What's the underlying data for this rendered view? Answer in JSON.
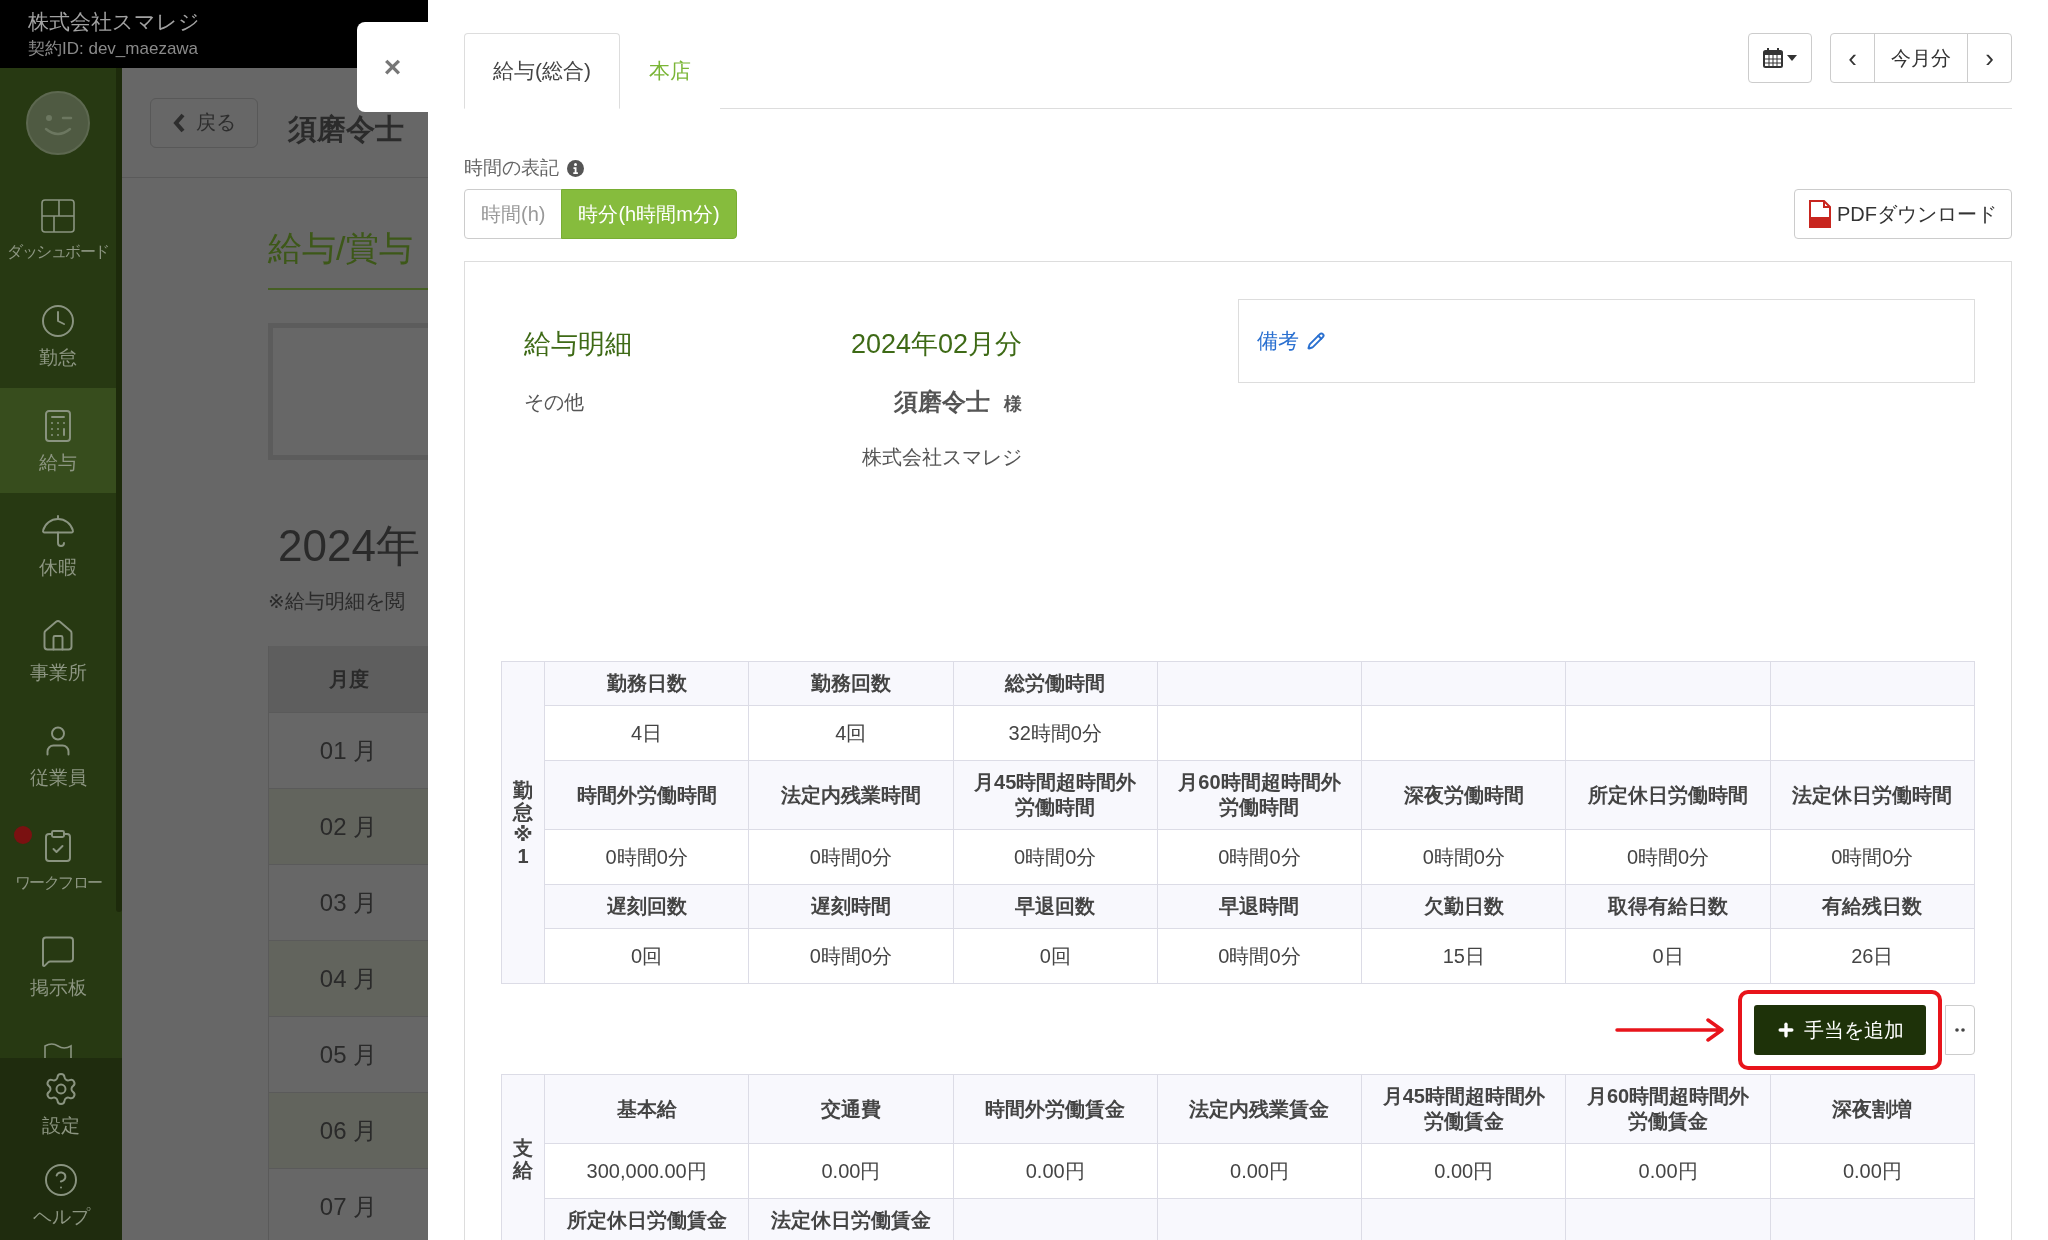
{
  "top_bar": {
    "company": "株式会社スマレジ",
    "contract_id": "契約ID: dev_maezawa"
  },
  "sidebar": {
    "items": [
      {
        "label": "ダッシュボード",
        "selected": false,
        "alert": false
      },
      {
        "label": "勤怠",
        "selected": false,
        "alert": false
      },
      {
        "label": "給与",
        "selected": true,
        "alert": false
      },
      {
        "label": "休暇",
        "selected": false,
        "alert": false
      },
      {
        "label": "事業所",
        "selected": false,
        "alert": false
      },
      {
        "label": "従業員",
        "selected": false,
        "alert": false
      },
      {
        "label": "ワークフロー",
        "selected": false,
        "alert": true
      },
      {
        "label": "掲示板",
        "selected": false,
        "alert": false
      }
    ],
    "footer_items": [
      {
        "label": "設定"
      },
      {
        "label": "ヘルプ"
      }
    ]
  },
  "page": {
    "back_button": "戻る",
    "employee_name": "須磨令士",
    "title": "給与/賞与",
    "year": "2024年",
    "note": "※給与明細を閲",
    "months_table": {
      "header": "月度",
      "rows": [
        "01 月",
        "02 月",
        "03 月",
        "04 月",
        "05 月",
        "06 月",
        "07 月"
      ]
    }
  },
  "drawer": {
    "close_button": "×",
    "tabs": [
      {
        "label": "給与(総合)",
        "selected": true
      },
      {
        "label": "本店",
        "selected": false
      }
    ],
    "pager": {
      "previous": "‹",
      "current": "今月分",
      "next": "›"
    },
    "time_format": {
      "label": "時間の表記",
      "options": [
        {
          "label": "時間(h)",
          "selected": false
        },
        {
          "label": "時分(h時間m分)",
          "selected": true
        }
      ]
    },
    "pdf_button": "PDFダウンロード",
    "slip": {
      "title": "給与明細",
      "period": "2024年02月分",
      "category": "その他",
      "employee": "須磨令士",
      "honorific": "様",
      "company": "株式会社スマレジ",
      "remarks_link": "備考",
      "attendance": {
        "label": "勤怠※1",
        "rows": [
          {
            "headers": [
              "勤務日数",
              "勤務回数",
              "総労働時間"
            ],
            "values": [
              "4日",
              "4回",
              "32時間0分"
            ]
          },
          {
            "headers": [
              "時間外労働時間",
              "法定内残業時間",
              "月45時間超時間外労働時間",
              "月60時間超時間外労働時間",
              "深夜労働時間",
              "所定休日労働時間",
              "法定休日労働時間"
            ],
            "values": [
              "0時間0分",
              "0時間0分",
              "0時間0分",
              "0時間0分",
              "0時間0分",
              "0時間0分",
              "0時間0分"
            ]
          },
          {
            "headers": [
              "遅刻回数",
              "遅刻時間",
              "早退回数",
              "早退時間",
              "欠勤日数",
              "取得有給日数",
              "有給残日数"
            ],
            "values": [
              "0回",
              "0時間0分",
              "0回",
              "0時間0分",
              "15日",
              "0日",
              "26日"
            ]
          }
        ]
      },
      "add_allowance": {
        "label": "手当を追加",
        "highlighted": true
      },
      "payments": {
        "label": "支給",
        "rows": [
          {
            "headers": [
              "基本給",
              "交通費",
              "時間外労働賃金",
              "法定内残業賃金",
              "月45時間超時間外労働賃金",
              "月60時間超時間外労働賃金",
              "深夜割増"
            ],
            "values": [
              "300,000.00円",
              "0.00円",
              "0.00円",
              "0.00円",
              "0.00円",
              "0.00円",
              "0.00円"
            ]
          },
          {
            "headers": [
              "所定休日労働賃金",
              "法定休日労働賃金"
            ]
          }
        ]
      }
    }
  }
}
